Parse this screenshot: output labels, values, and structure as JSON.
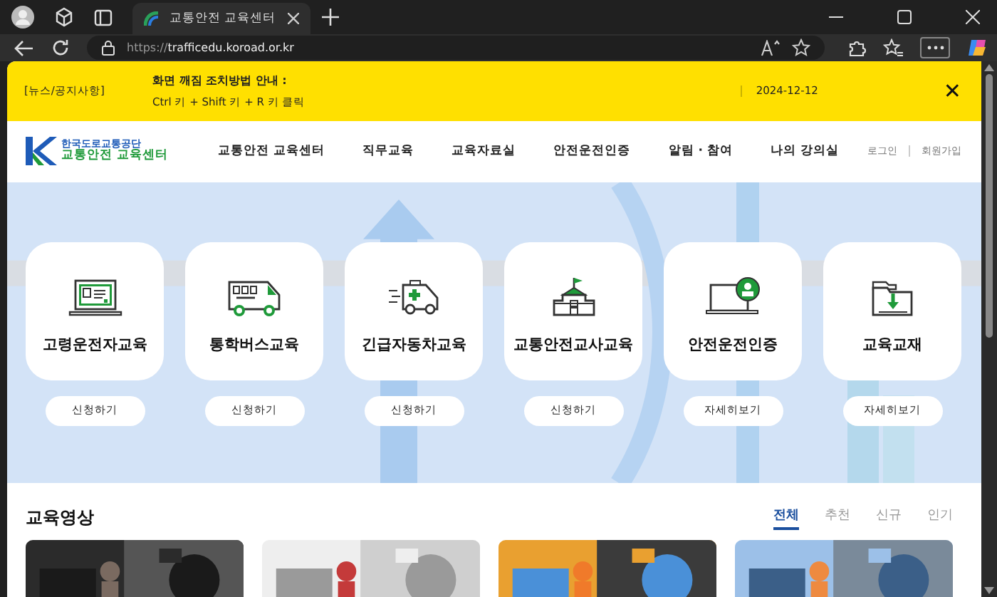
{
  "browser": {
    "tabs": [
      {
        "title": "교통안전 교육센터",
        "selected": true
      }
    ],
    "url_scheme": "https://",
    "url_host": "trafficedu.koroad.or.kr"
  },
  "notice": {
    "tag": "[뉴스/공지사항]",
    "title": "화면 깨짐 조치방법 안내 :",
    "detail": "Ctrl 키 + Shift 키 + R 키 클릭",
    "date": "2024-12-12",
    "close": "✕"
  },
  "header": {
    "logo_top": "한국도로교통공단",
    "logo_bottom": "교통안전 교육센터",
    "nav": [
      "교통안전 교육센터",
      "직무교육",
      "교육자료실",
      "안전운전인증",
      "알림 · 참여",
      "나의 강의실"
    ],
    "links": [
      "로그인",
      "회원가입"
    ]
  },
  "cards": [
    {
      "title": "고령운전자교육",
      "button": "신청하기"
    },
    {
      "title": "통학버스교육",
      "button": "신청하기"
    },
    {
      "title": "긴급자동차교육",
      "button": "신청하기"
    },
    {
      "title": "교통안전교사교육",
      "button": "신청하기"
    },
    {
      "title": "안전운전인증",
      "button": "자세히보기"
    },
    {
      "title": "교육교재",
      "button": "자세히보기"
    }
  ],
  "videos": {
    "title": "교육영상",
    "filters": [
      {
        "label": "전체",
        "selected": true
      },
      {
        "label": "추천",
        "selected": false
      },
      {
        "label": "신규",
        "selected": false
      },
      {
        "label": "인기",
        "selected": false
      }
    ]
  }
}
